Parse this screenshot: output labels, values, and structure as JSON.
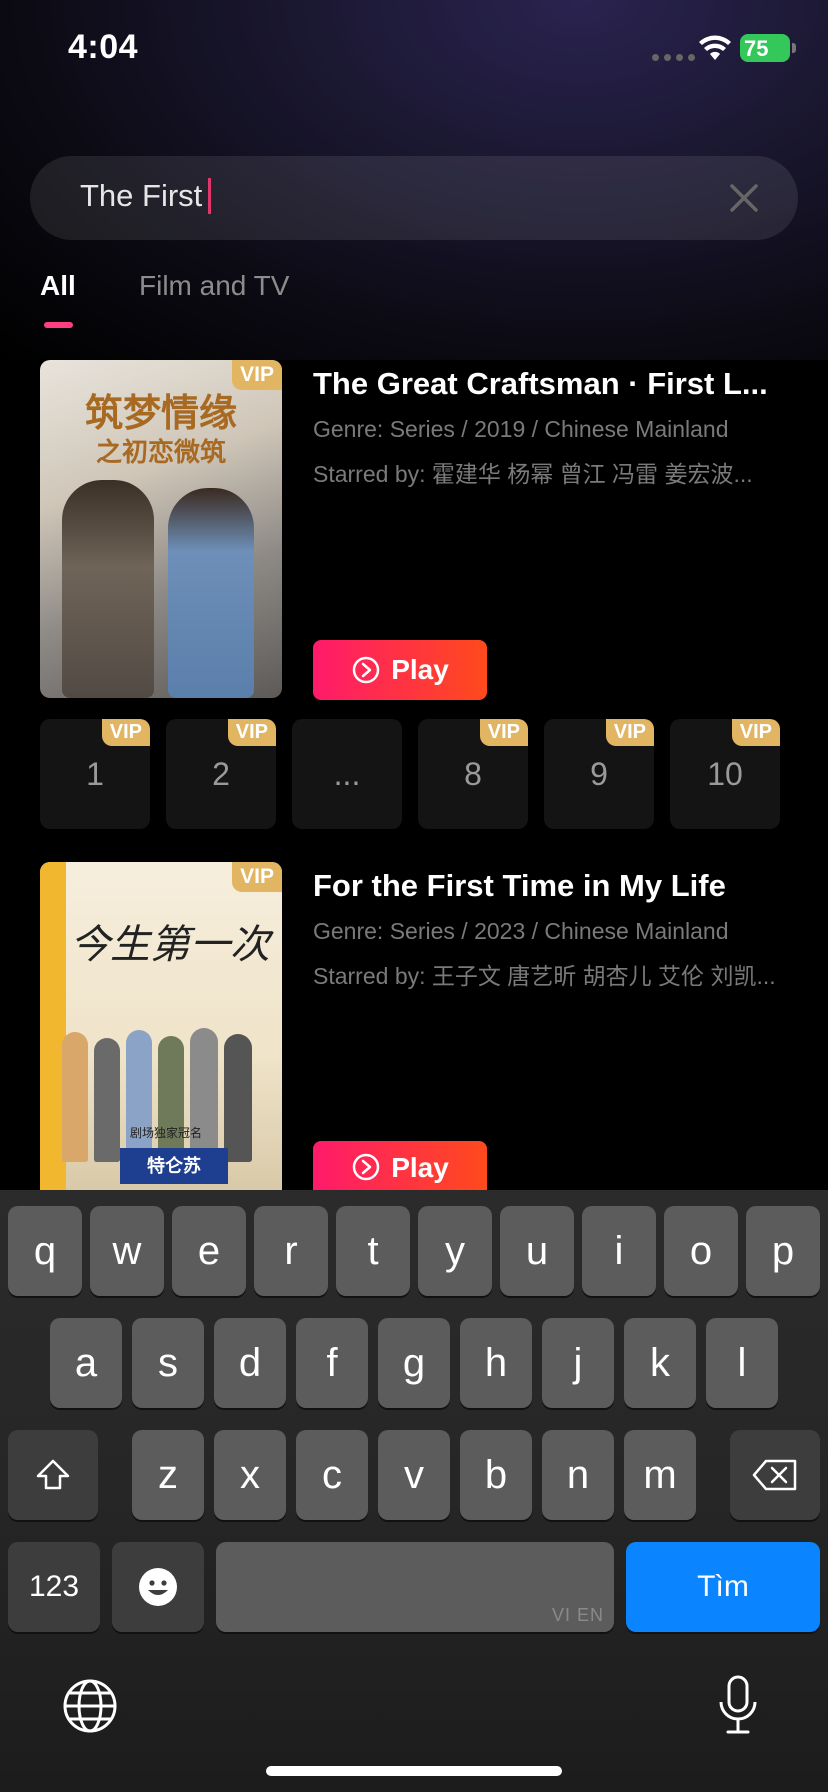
{
  "status_bar": {
    "time": "4:04",
    "battery": "75"
  },
  "search": {
    "query": "The First"
  },
  "tabs": [
    {
      "label": "All",
      "active": true
    },
    {
      "label": "Film and TV",
      "active": false
    }
  ],
  "results": [
    {
      "title": "The Great Craftsman · First L...",
      "meta": "Genre: Series / 2019 / Chinese Mainland",
      "cast": "Starred by: 霍建华 杨幂 曾江 冯雷 姜宏波...",
      "badge": "VIP",
      "poster_title": "筑梦情缘",
      "poster_subtitle": "之初恋微筑",
      "play_label": "Play",
      "episodes": [
        {
          "label": "1",
          "vip": "VIP"
        },
        {
          "label": "2",
          "vip": "VIP"
        },
        {
          "label": "...",
          "vip": ""
        },
        {
          "label": "8",
          "vip": "VIP"
        },
        {
          "label": "9",
          "vip": "VIP"
        },
        {
          "label": "10",
          "vip": "VIP"
        }
      ]
    },
    {
      "title": "For the First Time in My Life",
      "meta": "Genre: Series / 2023 / Chinese Mainland",
      "cast": "Starred by: 王子文 唐艺昕 胡杏儿 艾伦 刘凯...",
      "badge": "VIP",
      "poster_title": "今生第一次",
      "poster_sponsor": "剧场独家冠名",
      "poster_logo": "特仑苏",
      "play_label": "Play"
    }
  ],
  "keyboard": {
    "row1": [
      "q",
      "w",
      "e",
      "r",
      "t",
      "y",
      "u",
      "i",
      "o",
      "p"
    ],
    "row2": [
      "a",
      "s",
      "d",
      "f",
      "g",
      "h",
      "j",
      "k",
      "l"
    ],
    "row3": [
      "z",
      "x",
      "c",
      "v",
      "b",
      "n",
      "m"
    ],
    "numbers_label": "123",
    "space_lang": "VI EN",
    "search_label": "Tìm"
  },
  "colors": {
    "accent_pink": "#ff3d7f",
    "play_gradient_start": "#ff1a6b",
    "play_gradient_end": "#ff4a1c",
    "vip_gold": "#e2b563",
    "key_blue": "#0a84ff"
  }
}
